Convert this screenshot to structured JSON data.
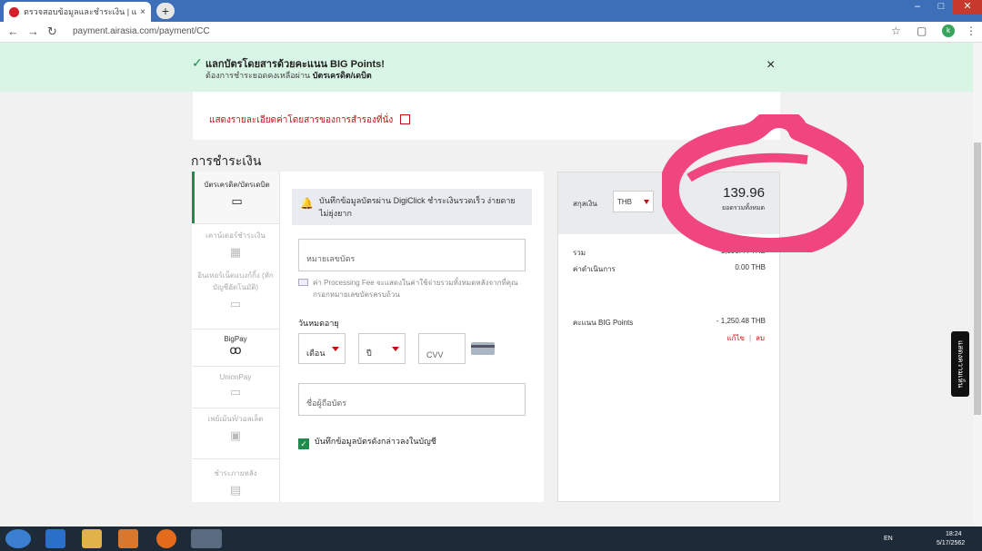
{
  "browser": {
    "tab_title": "ตรวจสอบข้อมูลและชำระเงิน | แอร์เอ",
    "tab_close": "×",
    "new_tab": "+",
    "url": "payment.airasia.com/payment/CC",
    "avatar_letter": "k"
  },
  "banner": {
    "line1": "แลกบัตรโดยสารด้วยคะแนน BIG Points!",
    "line2_prefix": "ต้องการชำระยอดคงเหลือผ่าน",
    "line2_bold": "บัตรเครดิต/เดบิต",
    "close": "×"
  },
  "fare": {
    "details_link": "แสดงรายละเอียดค่าโดยสารของการสำรองที่นั่ง"
  },
  "section_title": "การชำระเงิน",
  "menu": {
    "items": [
      {
        "label": "บัตรเครดิต/บัตรเดบิต"
      },
      {
        "label": "เคาน์เตอร์ชำระเงิน"
      },
      {
        "label": "อินเทอร์เน็ตแบงก์กิ้ง (หักบัญชีอัตโนมัติ)"
      },
      {
        "label": "BigPay"
      },
      {
        "label": "UnionPay"
      },
      {
        "label": "เพย์เม้นท์/วอลเล็ต"
      },
      {
        "label": "ชำระภายหลัง"
      }
    ]
  },
  "form": {
    "notice": "บันทึกข้อมูลบัตรผ่าน DigiClick ชำระเงินรวดเร็ว ง่ายดาย ไม่ยุ่งยาก",
    "card_number_placeholder": "หมายเลขบัตร",
    "fee_note": "ค่า Processing Fee จะแสดงในค่าใช้จ่ายรวมทั้งหมดหลังจากที่คุณกรอกหมายเลขบัตรครบถ้วน",
    "expiry_label": "วันหมดอายุ",
    "month_placeholder": "เดือน",
    "year_placeholder": "ปี",
    "cvv_placeholder": "CVV",
    "holder_placeholder": "ชื่อผู้ถือบัตร",
    "save_label": "บันทึกข้อมูลบัตรดังกล่าวลงในบัญชี",
    "save_check": "✓"
  },
  "summary": {
    "currency_label": "สกุลเงิน",
    "currency": "THB",
    "total": "139.96",
    "total_sub": "ยอดรวมทั้งหมด",
    "rows": [
      {
        "label": "รวม",
        "value": "1,390.44 THB"
      },
      {
        "label": "ค่าดำเนินการ",
        "value": "0.00 THB"
      }
    ],
    "points_label": "คะแนน BIG Points",
    "points_value": "- 1,250.48 THB",
    "edit": "แก้ไข",
    "remove": "ลบ"
  },
  "feedback_tab": "แสดงความเห็น",
  "taskbar": {
    "lang": "EN",
    "time": "18:24",
    "date": "5/17/2562"
  },
  "colors": {
    "brand_red": "#c01414",
    "green": "#1e8a4b",
    "banner_bg": "#d9f5e6",
    "scribble_pink": "#f0457f"
  }
}
